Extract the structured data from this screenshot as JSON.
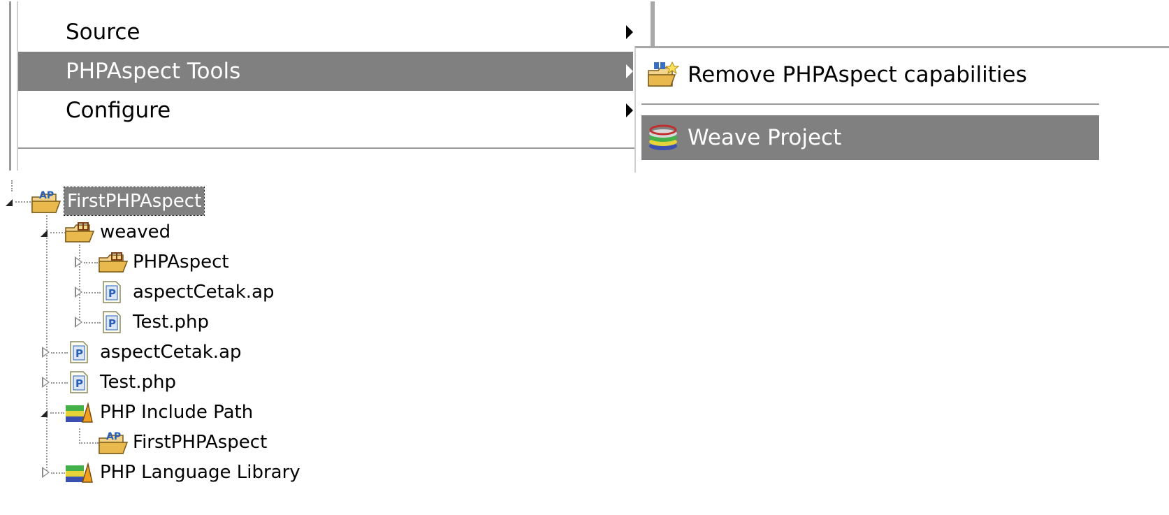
{
  "context_menu": {
    "items": [
      {
        "label": "Source",
        "has_submenu": true,
        "highlighted": false
      },
      {
        "label": "PHPAspect Tools",
        "has_submenu": true,
        "highlighted": true
      },
      {
        "label": "Configure",
        "has_submenu": true,
        "highlighted": false
      }
    ],
    "highlight_color": "#808080"
  },
  "submenu": {
    "items": [
      {
        "label": "Remove PHPAspect capabilities",
        "icon": "remove-capabilities-icon",
        "highlighted": false
      },
      {
        "label": "Weave Project",
        "icon": "weave-project-icon",
        "highlighted": true
      }
    ]
  },
  "tree": {
    "root": {
      "label": "FirstPHPAspect",
      "icon": "aspect-project-icon",
      "selected": true,
      "expanded": true
    },
    "nodes": [
      {
        "label": "weaved",
        "icon": "package-folder-icon",
        "expanded": true
      },
      {
        "label": "PHPAspect",
        "icon": "package-folder-icon",
        "expanded": false
      },
      {
        "label": "aspectCetak.ap",
        "icon": "php-file-icon",
        "expanded": false
      },
      {
        "label": "Test.php",
        "icon": "php-file-icon",
        "expanded": false
      },
      {
        "label": "aspectCetak.ap",
        "icon": "php-file-icon",
        "expanded": false
      },
      {
        "label": "Test.php",
        "icon": "php-file-icon",
        "expanded": false
      },
      {
        "label": "PHP Include Path",
        "icon": "library-icon",
        "expanded": true
      },
      {
        "label": "FirstPHPAspect",
        "icon": "aspect-project-icon"
      },
      {
        "label": "PHP Language Library",
        "icon": "library-icon",
        "expanded": false
      }
    ]
  }
}
